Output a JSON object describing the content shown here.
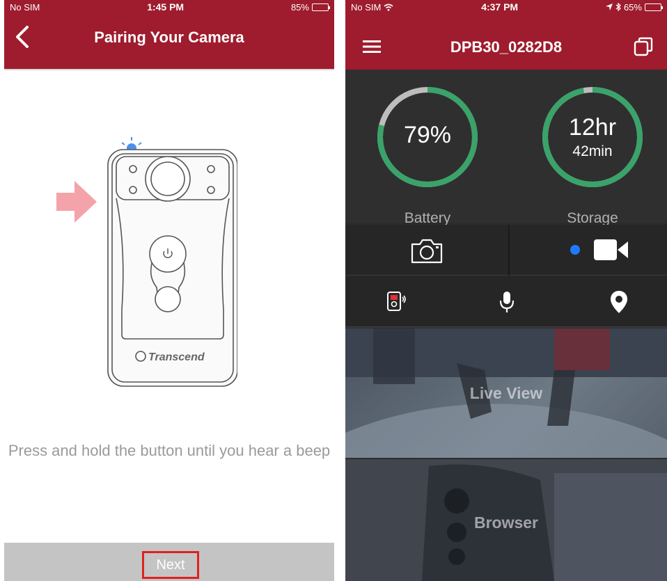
{
  "left_screen": {
    "status_bar": {
      "carrier": "No SIM",
      "time": "1:45 PM",
      "battery": "85%"
    },
    "nav": {
      "title": "Pairing Your Camera"
    },
    "illustration": {
      "brand": "Transcend"
    },
    "instruction": "Press and hold the button until you hear a beep",
    "next_label": "Next"
  },
  "right_screen": {
    "status_bar": {
      "carrier": "No SIM",
      "time": "4:37 PM",
      "battery": "65%"
    },
    "nav": {
      "title": "DPB30_0282D8"
    },
    "battery": {
      "value": "79%",
      "label": "Battery",
      "fraction": 0.79
    },
    "storage": {
      "hours": "12hr",
      "minutes": "42min",
      "label": "Storage",
      "fraction": 0.97
    },
    "panels": {
      "live_view": "Live View",
      "browser": "Browser"
    }
  },
  "colors": {
    "brand_red": "#9e1c2d",
    "gauge_green": "#3aa36a",
    "gauge_track": "#bdbdbd",
    "recording_dot": "#1e7bff",
    "arrow_pink": "#f3a3a9",
    "led_blue": "#4a90f0"
  }
}
